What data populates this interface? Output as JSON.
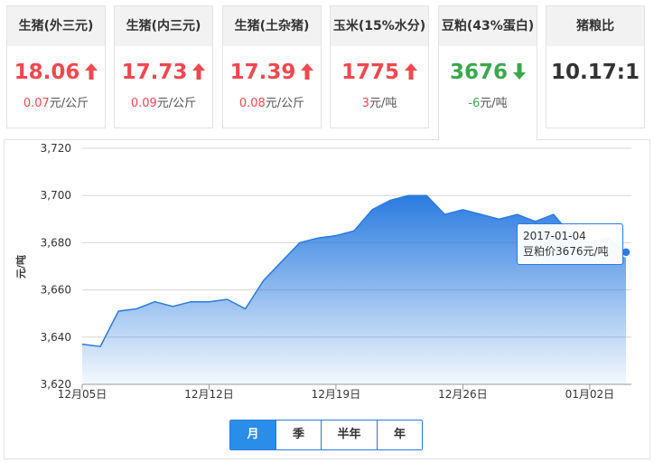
{
  "cards": [
    {
      "title": "生猪(外三元)",
      "price": "18.06",
      "change_value": "0.07",
      "change_unit": "元/公斤",
      "trend": "up",
      "trend_color": "#f0484f"
    },
    {
      "title": "生猪(内三元)",
      "price": "17.73",
      "change_value": "0.09",
      "change_unit": "元/公斤",
      "trend": "up",
      "trend_color": "#f0484f"
    },
    {
      "title": "生猪(土杂猪)",
      "price": "17.39",
      "change_value": "0.08",
      "change_unit": "元/公斤",
      "trend": "up",
      "trend_color": "#f0484f"
    },
    {
      "title": "玉米(15%水分)",
      "price": "1775",
      "change_value": "3",
      "change_unit": "元/吨",
      "trend": "up",
      "trend_color": "#f0484f"
    },
    {
      "title": "豆粕(43%蛋白)",
      "price": "3676",
      "change_value": "-6",
      "change_unit": "元/吨",
      "trend": "down",
      "trend_color": "#3aa84a"
    },
    {
      "title": "猪粮比",
      "price": "10.17:1",
      "change_value": "",
      "change_unit": "",
      "trend": "none",
      "trend_color": "#333333"
    }
  ],
  "tooltip": {
    "date": "2017-01-04",
    "text": "豆粕价3676元/吨"
  },
  "periods": [
    {
      "label": "月",
      "active": true
    },
    {
      "label": "季",
      "active": false
    },
    {
      "label": "半年",
      "active": false
    },
    {
      "label": "年",
      "active": false
    }
  ],
  "chart_data": {
    "type": "area",
    "ylabel": "元/吨",
    "ylim": [
      3620,
      3720
    ],
    "yticks": [
      "3,620",
      "3,640",
      "3,660",
      "3,680",
      "3,700",
      "3,720"
    ],
    "xtick_labels": [
      "12月05日",
      "12月12日",
      "12月19日",
      "12月26日",
      "01月02日"
    ],
    "xtick_index": [
      0,
      7,
      14,
      21,
      28
    ],
    "x": [
      "12-05",
      "12-06",
      "12-07",
      "12-08",
      "12-09",
      "12-10",
      "12-11",
      "12-12",
      "12-13",
      "12-14",
      "12-15",
      "12-16",
      "12-17",
      "12-18",
      "12-19",
      "12-20",
      "12-21",
      "12-22",
      "12-23",
      "12-24",
      "12-25",
      "12-26",
      "12-27",
      "12-28",
      "12-29",
      "12-30",
      "12-31",
      "01-01",
      "01-02",
      "01-03",
      "01-04"
    ],
    "series": [
      {
        "values": [
          3637,
          3636,
          3651,
          3652,
          3655,
          3653,
          3655,
          3655,
          3656,
          3652,
          3664,
          3672,
          3680,
          3682,
          3683,
          3685,
          3694,
          3698,
          3700,
          3700,
          3692,
          3694,
          3692,
          3690,
          3692,
          3689,
          3692,
          3683,
          3680,
          3682,
          3676
        ]
      }
    ],
    "grid": true,
    "accent": "#2a7be0"
  }
}
